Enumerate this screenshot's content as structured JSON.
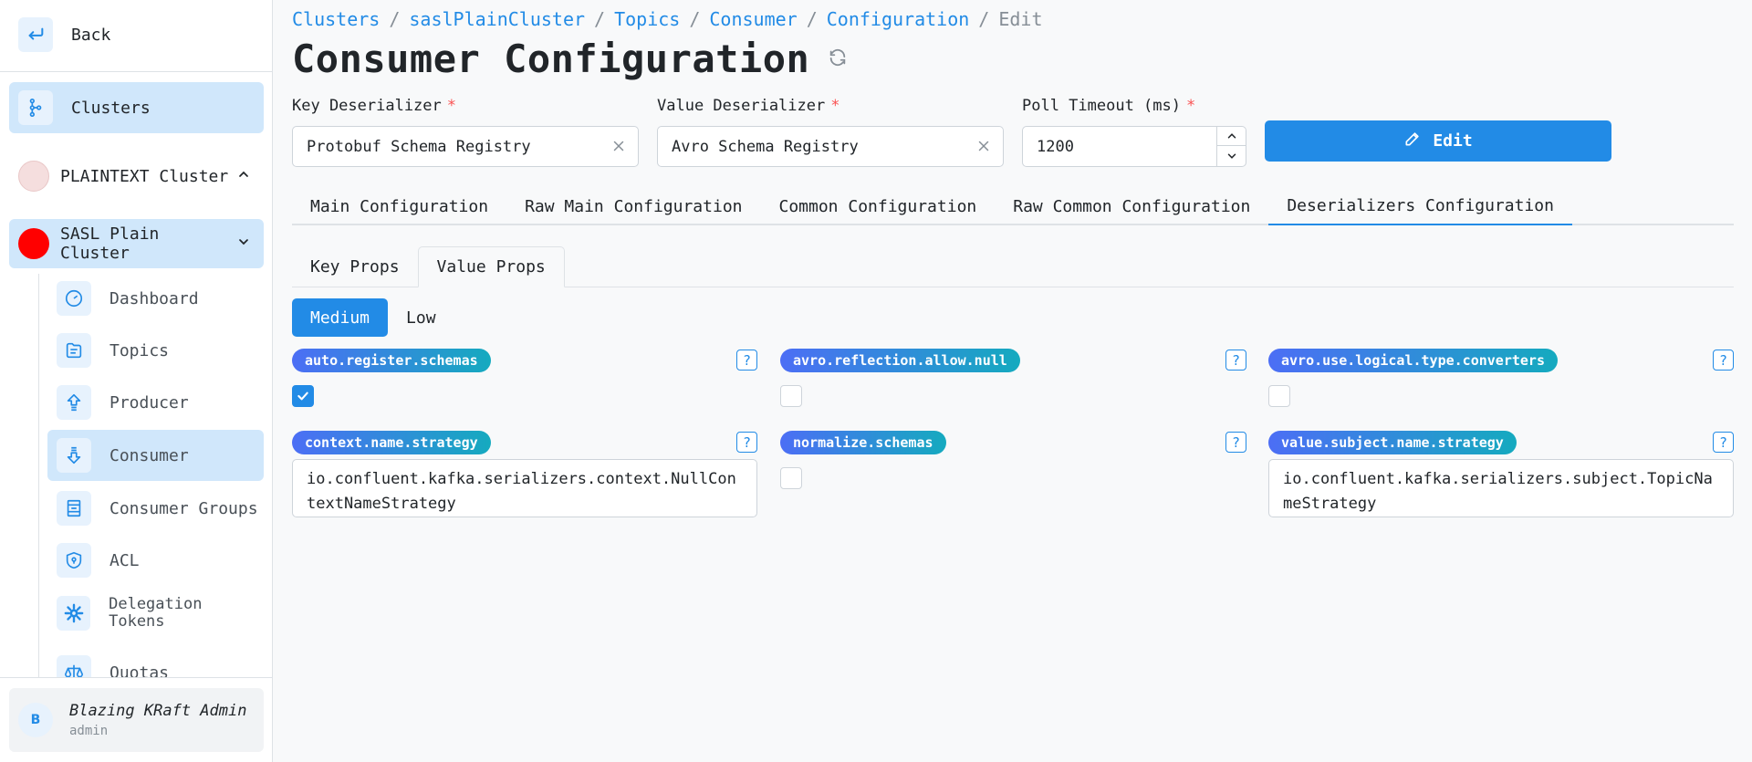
{
  "sidebar": {
    "back_label": "Back",
    "clusters_label": "Clusters",
    "plaintext_cluster": {
      "label": "PLAINTEXT Cluster",
      "color": "#f5dede"
    },
    "sasl_cluster": {
      "label": "SASL Plain Cluster",
      "color": "#ff0000"
    },
    "items": [
      {
        "label": "Dashboard",
        "icon": "dashboard-icon"
      },
      {
        "label": "Topics",
        "icon": "topics-icon"
      },
      {
        "label": "Producer",
        "icon": "producer-icon"
      },
      {
        "label": "Consumer",
        "icon": "consumer-icon",
        "active": true
      },
      {
        "label": "Consumer Groups",
        "icon": "consumer-groups-icon"
      },
      {
        "label": "ACL",
        "icon": "acl-icon"
      },
      {
        "label": "Delegation Tokens",
        "icon": "delegation-tokens-icon"
      },
      {
        "label": "Quotas",
        "icon": "quotas-icon"
      }
    ],
    "user": {
      "avatar": "B",
      "name": "Blazing KRaft Admin",
      "role": "admin"
    }
  },
  "breadcrumb": {
    "items": [
      "Clusters",
      "saslPlainCluster",
      "Topics",
      "Consumer",
      "Configuration"
    ],
    "current": "Edit",
    "separator": "/"
  },
  "page_title": "Consumer Configuration",
  "form": {
    "key_deserializer": {
      "label": "Key Deserializer",
      "value": "Protobuf Schema Registry",
      "required": "*"
    },
    "value_deserializer": {
      "label": "Value Deserializer",
      "value": "Avro Schema Registry",
      "required": "*"
    },
    "poll_timeout": {
      "label": "Poll Timeout (ms)",
      "value": "1200",
      "required": "*"
    },
    "edit_label": "Edit"
  },
  "tabs": [
    "Main Configuration",
    "Raw Main Configuration",
    "Common Configuration",
    "Raw Common Configuration",
    "Deserializers Configuration"
  ],
  "active_tab": "Deserializers Configuration",
  "subtabs": [
    "Key Props",
    "Value Props"
  ],
  "active_subtab": "Value Props",
  "importance": {
    "options": [
      "Medium",
      "Low"
    ],
    "selected": "Medium"
  },
  "props": {
    "auto_register_schemas": {
      "name": "auto.register.schemas",
      "checked": true
    },
    "avro_reflection_allow_null": {
      "name": "avro.reflection.allow.null",
      "checked": false
    },
    "avro_use_logical_type_converters": {
      "name": "avro.use.logical.type.converters",
      "checked": false
    },
    "context_name_strategy": {
      "name": "context.name.strategy",
      "value": "io.confluent.kafka.serializers.context.NullContextNameStrategy"
    },
    "normalize_schemas": {
      "name": "normalize.schemas",
      "checked": false
    },
    "value_subject_name_strategy": {
      "name": "value.subject.name.strategy",
      "value": "io.confluent.kafka.serializers.subject.TopicNameStrategy"
    }
  },
  "help_glyph": "?",
  "colors": {
    "accent": "#228be6",
    "active_nav": "#d0e7fb",
    "required": "#fa5252"
  }
}
